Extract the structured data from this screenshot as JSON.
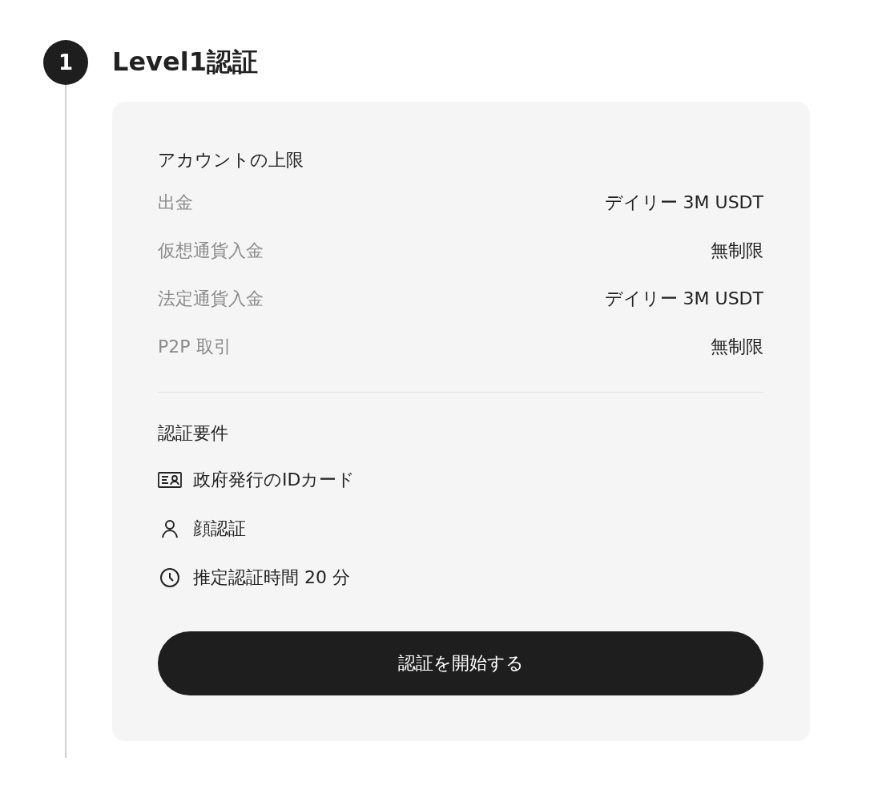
{
  "step": {
    "number": "1",
    "title": "Level1認証"
  },
  "limits": {
    "title": "アカウントの上限",
    "rows": [
      {
        "label": "出金",
        "value": "デイリー 3M USDT"
      },
      {
        "label": "仮想通貨入金",
        "value": "無制限"
      },
      {
        "label": "法定通貨入金",
        "value": "デイリー 3M USDT"
      },
      {
        "label": "P2P 取引",
        "value": "無制限"
      }
    ]
  },
  "requirements": {
    "title": "認証要件",
    "items": [
      {
        "kind": "id-card",
        "text": "政府発行のIDカード"
      },
      {
        "kind": "person",
        "text": "顔認証"
      },
      {
        "kind": "clock",
        "text": "推定認証時間 20 分"
      }
    ]
  },
  "button": "認証を開始する"
}
